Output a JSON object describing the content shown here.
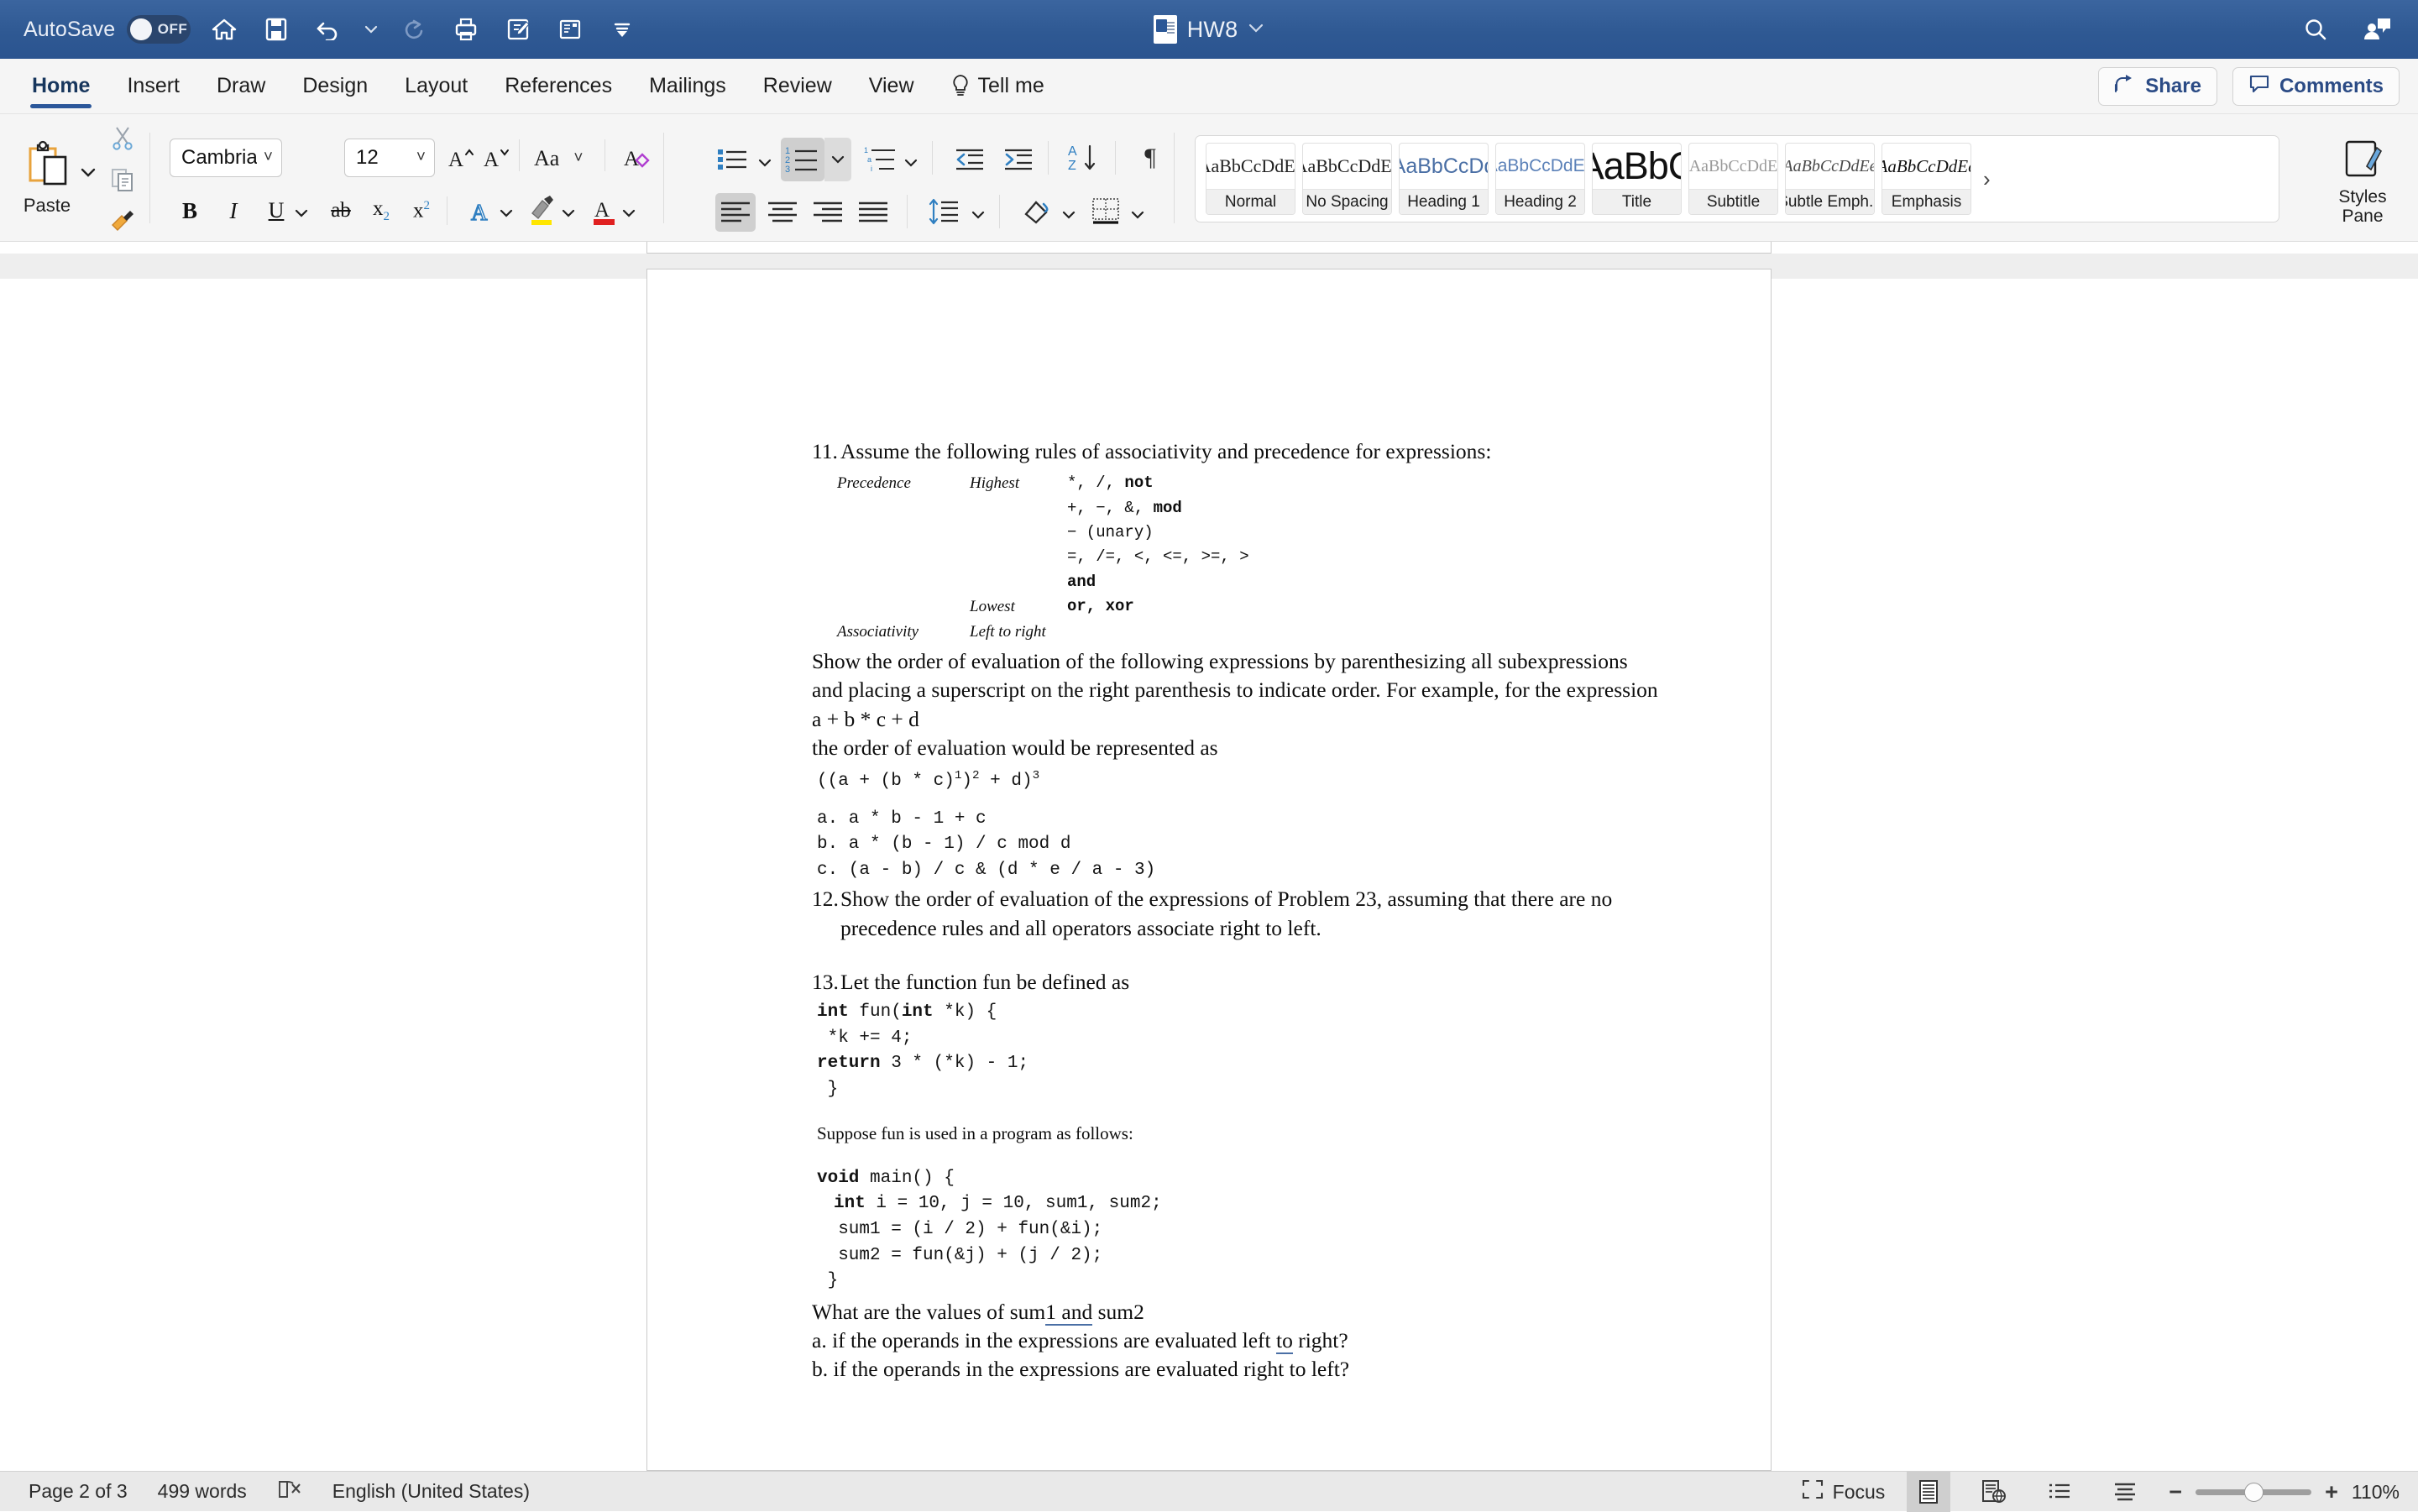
{
  "titlebar": {
    "autosave_label": "AutoSave",
    "autosave_state": "OFF",
    "document_name": "HW8",
    "quick_access": [
      {
        "name": "home-icon",
        "label": "Home"
      },
      {
        "name": "save-icon",
        "label": "Save"
      },
      {
        "name": "undo-icon",
        "label": "Undo"
      },
      {
        "name": "undo-dropdown-icon",
        "label": "Undo options"
      },
      {
        "name": "redo-icon",
        "label": "Redo"
      },
      {
        "name": "print-icon",
        "label": "Print"
      },
      {
        "name": "track-changes-icon",
        "label": "Track Changes"
      },
      {
        "name": "reading-view-icon",
        "label": "Reading View"
      },
      {
        "name": "customize-toolbar-icon",
        "label": "Customize Quick Access Toolbar"
      }
    ],
    "right_icons": [
      {
        "name": "search-icon",
        "label": "Search"
      },
      {
        "name": "account-icon",
        "label": "Account"
      }
    ]
  },
  "tabs": [
    {
      "label": "Home",
      "active": true
    },
    {
      "label": "Insert",
      "active": false
    },
    {
      "label": "Draw",
      "active": false
    },
    {
      "label": "Design",
      "active": false
    },
    {
      "label": "Layout",
      "active": false
    },
    {
      "label": "References",
      "active": false
    },
    {
      "label": "Mailings",
      "active": false
    },
    {
      "label": "Review",
      "active": false
    },
    {
      "label": "View",
      "active": false
    },
    {
      "label": "Tell me",
      "active": false
    }
  ],
  "tabs_right": {
    "share_label": "Share",
    "comments_label": "Comments"
  },
  "ribbon": {
    "clipboard": {
      "paste_label": "Paste",
      "cut_label": "Cut",
      "copy_label": "Copy",
      "format_painter_label": "Format Painter"
    },
    "font": {
      "font_name": "Cambria (B...",
      "font_size": "12",
      "grow_font_label": "Grow Font",
      "shrink_font_label": "Shrink Font",
      "change_case_label": "Aa",
      "clear_formatting_label": "Clear Formatting",
      "bold_label": "B",
      "italic_label": "I",
      "underline_label": "U",
      "strikethrough_label": "ab",
      "subscript_label": "x",
      "superscript_label": "x",
      "text_effects_label": "A",
      "highlight_label": "Text Highlight Color",
      "font_color_label": "A"
    },
    "paragraph": {
      "bullets_label": "Bullets",
      "numbering_label": "Numbering",
      "multilevel_label": "Multilevel List",
      "decrease_indent_label": "Decrease Indent",
      "increase_indent_label": "Increase Indent",
      "sort_label": "Sort",
      "show_marks_label": "Show/Hide ¶",
      "align_left_label": "Align Left",
      "align_center_label": "Center",
      "align_right_label": "Align Right",
      "justify_label": "Justify",
      "line_spacing_label": "Line Spacing",
      "shading_label": "Shading",
      "borders_label": "Borders"
    },
    "styles": {
      "items": [
        {
          "preview": "AaBbCcDdEe",
          "name": "Normal",
          "cls": "sp-normal"
        },
        {
          "preview": "AaBbCcDdEe",
          "name": "No Spacing",
          "cls": "sp-nospace"
        },
        {
          "preview": "AaBbCcDd",
          "name": "Heading 1",
          "cls": "sp-h1"
        },
        {
          "preview": "AaBbCcDdEe",
          "name": "Heading 2",
          "cls": "sp-h2"
        },
        {
          "preview": "AaBbC",
          "name": "Title",
          "cls": "sp-title"
        },
        {
          "preview": "AaBbCcDdE",
          "name": "Subtitle",
          "cls": "sp-sub"
        },
        {
          "preview": "AaBbCcDdEe",
          "name": "Subtle Emph...",
          "cls": "sp-subemp"
        },
        {
          "preview": "AaBbCcDdEe",
          "name": "Emphasis",
          "cls": "sp-emp"
        }
      ],
      "more_label": "›",
      "styles_pane_line1": "Styles",
      "styles_pane_line2": "Pane"
    }
  },
  "document": {
    "q11": {
      "number": "11.",
      "text": "Assume the following rules of associativity and precedence for expressions:"
    },
    "precedence_table": {
      "rows": [
        {
          "c1": "Precedence",
          "c2": "Highest",
          "c3": "*, /, ",
          "c3b": "not"
        },
        {
          "c1": "",
          "c2": "",
          "c3": "+, −, &, ",
          "c3b": "mod"
        },
        {
          "c1": "",
          "c2": "",
          "c3": "− (unary)",
          "c3b": ""
        },
        {
          "c1": "",
          "c2": "",
          "c3": "=, /=, <, <=, >=, >",
          "c3b": ""
        },
        {
          "c1": "",
          "c2": "",
          "c3": "",
          "c3b": "and"
        },
        {
          "c1": "",
          "c2": "Lowest",
          "c3": "",
          "c3b": "or, xor"
        },
        {
          "c1": "Associativity",
          "c2": "Left to right",
          "c3": "",
          "c3b": ""
        }
      ]
    },
    "body1": "Show the order of evaluation of the following expressions by parenthesizing all subexpressions and placing a superscript on the right parenthesis to indicate order. For example, for the expression",
    "expr_example": "a + b * c + d",
    "body2": "the order of evaluation would be represented as",
    "expr_result_pre": "((a + (b * c)",
    "expr_result_s1": "1",
    "expr_result_mid": ")",
    "expr_result_s2": "2",
    "expr_result_post": " + d)",
    "expr_result_s3": "3",
    "expr_list": [
      "a. a * b - 1 + c",
      "b. a * (b - 1) / c mod d",
      "c. (a - b) / c & (d * e / a - 3)"
    ],
    "q12": {
      "number": "12.",
      "text": "Show the order of evaluation of the expressions of Problem 23, assuming that there are no precedence rules and all operators associate right to left."
    },
    "q13": {
      "number": "13.",
      "text": "Let the function fun be defined as"
    },
    "code_fun": [
      {
        "bold": "int",
        "rest": " fun(",
        "bold2": "int",
        "rest2": " *k) {"
      },
      {
        "plain": " *k += 4;"
      },
      {
        "bold": "return",
        "rest": " 3 * (*k) - 1;"
      },
      {
        "plain": " }"
      }
    ],
    "suppose_text": "Suppose fun is used in a program as follows:",
    "code_main": [
      {
        "bold": "void",
        "rest": " main() {"
      },
      {
        "bold": "int",
        "rest": " i = 10, j = 10, sum1, sum2;",
        "indent": true
      },
      {
        "plain": "  sum1 = (i / 2) + fun(&i);"
      },
      {
        "plain": "  sum2 = fun(&j) + (j / 2);"
      },
      {
        "plain": " }"
      }
    ],
    "question_pre": "What are the values of sum",
    "question_mark": "1  and",
    "question_post": " sum2",
    "question_a_pre": "a. if the operands in the expressions are evaluated left ",
    "question_a_mark": "to",
    "question_a_post": " right?",
    "question_b": "b. if the operands in the expressions are evaluated right to left?"
  },
  "status": {
    "page_label": "Page 2 of 3",
    "word_count": "499 words",
    "proofing_icon_label": "Proofing errors",
    "language": "English (United States)",
    "focus_label": "Focus",
    "views": [
      {
        "name": "print-layout-view",
        "selected": true
      },
      {
        "name": "web-layout-view",
        "selected": false
      },
      {
        "name": "outline-view",
        "selected": false
      },
      {
        "name": "draft-view",
        "selected": false
      }
    ],
    "zoom_out_label": "−",
    "zoom_in_label": "+",
    "zoom_value": "110%"
  },
  "colors": {
    "titlebar": "#2f5993",
    "accent": "#2b579a",
    "ribbon_bg": "#f5f5f5",
    "status_bg": "#e9e9e9",
    "highlight_yellow": "#ffe600",
    "font_color_red": "#e02020",
    "spell_underline": "#4a6fa5"
  }
}
